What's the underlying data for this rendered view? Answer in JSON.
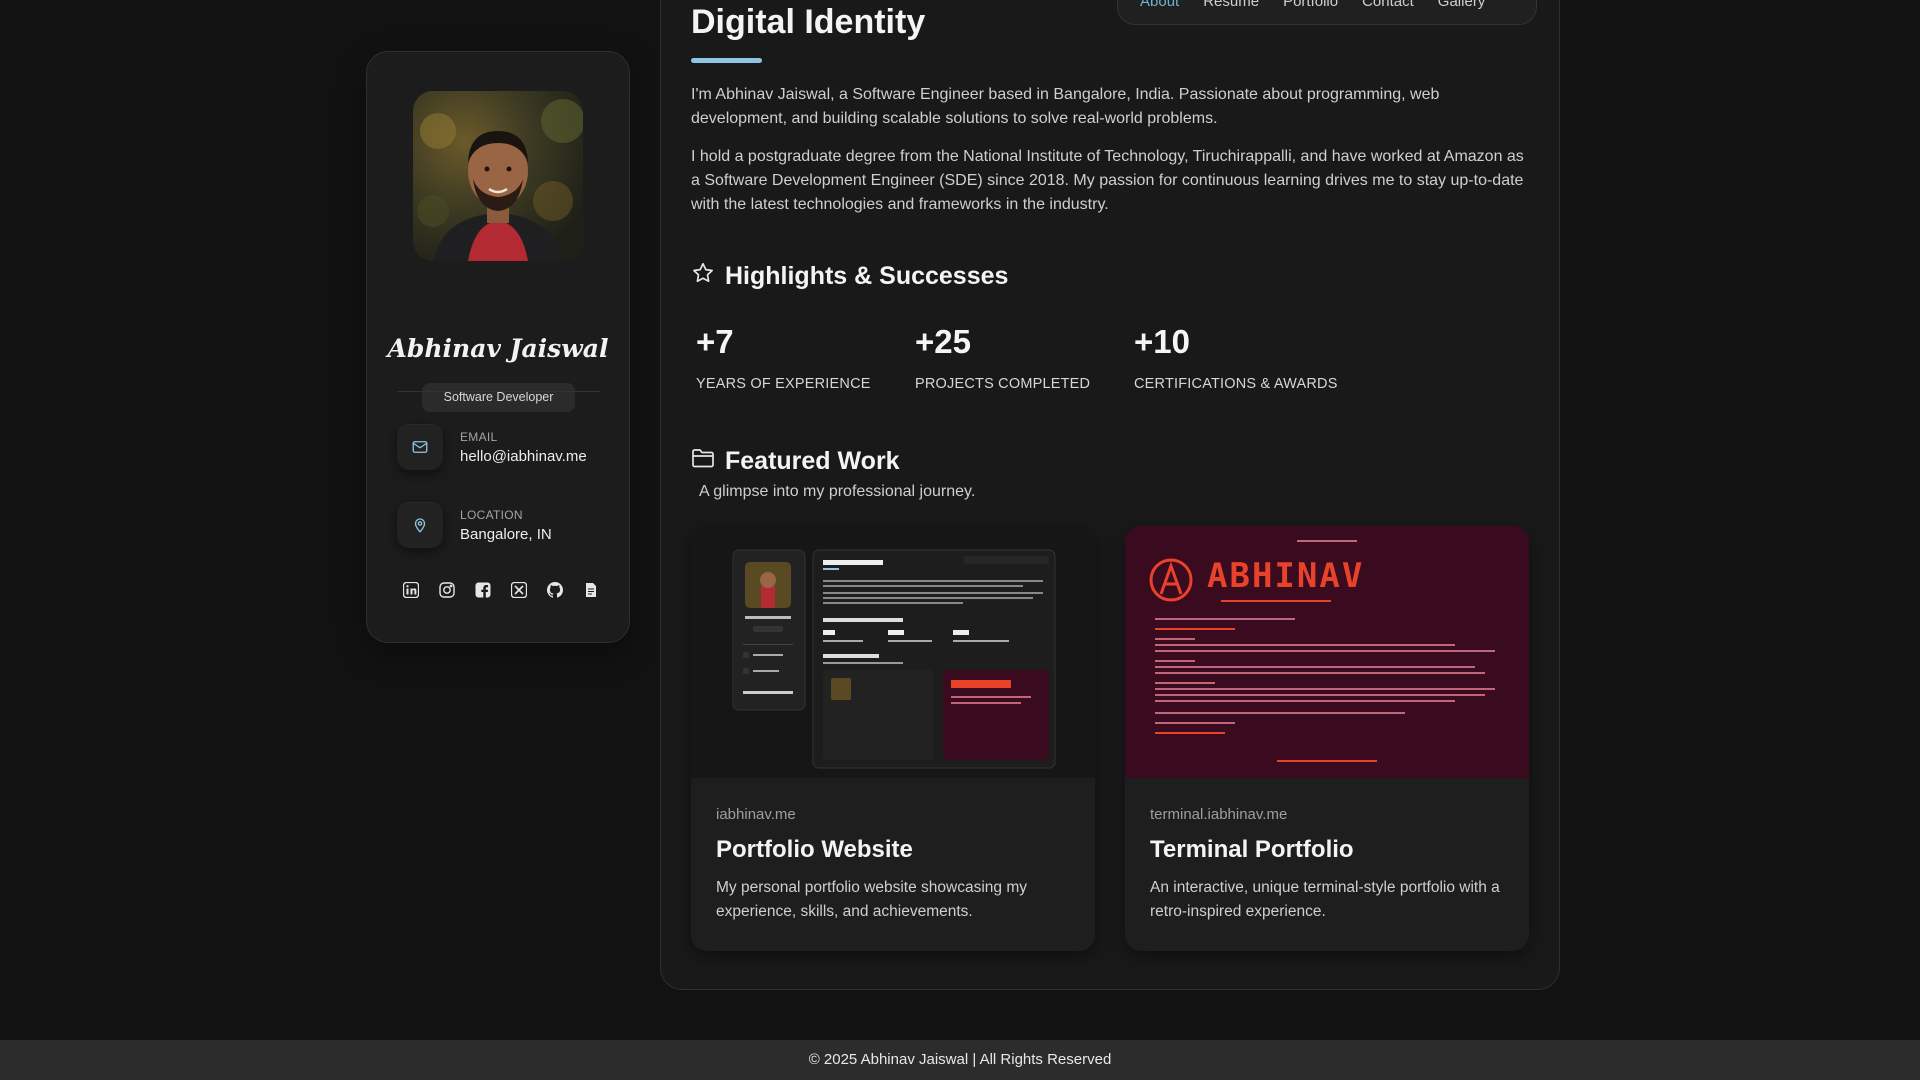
{
  "colors": {
    "accent": "#8fc5e0",
    "nav_active": "#6fb3d2",
    "background": "#121212",
    "card_bg": "#1c1c1c",
    "terminal_bg": "#3a0a1f",
    "terminal_accent": "#e8432a"
  },
  "profile": {
    "name": "Abhinav Jaiswal",
    "role": "Software Developer",
    "email_label": "EMAIL",
    "email": "hello@iabhinav.me",
    "location_label": "LOCATION",
    "location": "Bangalore, IN",
    "socials": [
      "linkedin-icon",
      "instagram-icon",
      "facebook-icon",
      "x-icon",
      "github-icon",
      "resume-icon"
    ]
  },
  "nav": {
    "items": [
      "About",
      "Resume",
      "Portfolio",
      "Contact",
      "Gallery"
    ]
  },
  "about": {
    "title": "Digital Identity",
    "p1": "I'm Abhinav Jaiswal, a Software Engineer based in Bangalore, India. Passionate about programming, web development, and building scalable solutions to solve real-world problems.",
    "p2": "I hold a postgraduate degree from the National Institute of Technology, Tiruchirappalli, and have worked at Amazon as a Software Development Engineer (SDE) since 2018. My passion for continuous learning drives me to stay up-to-date with the latest technologies and frameworks in the industry."
  },
  "highlights": {
    "title": "Highlights & Successes",
    "stats": [
      {
        "value": "+7",
        "label": "YEARS OF EXPERIENCE"
      },
      {
        "value": "+25",
        "label": "PROJECTS COMPLETED"
      },
      {
        "value": "+10",
        "label": "CERTIFICATIONS & AWARDS"
      }
    ]
  },
  "featured": {
    "title": "Featured Work",
    "subtitle": "A glimpse into my professional journey.",
    "projects": [
      {
        "domain": "iabhinav.me",
        "title": "Portfolio Website",
        "description": "My personal portfolio website showcasing my experience, skills, and achievements."
      },
      {
        "domain": "terminal.iabhinav.me",
        "title": "Terminal Portfolio",
        "description": "An interactive, unique terminal-style portfolio with a retro-inspired experience.",
        "logo_text": "ABHINAV"
      }
    ]
  },
  "footer": {
    "text": "© 2025 Abhinav Jaiswal | All Rights Reserved"
  }
}
